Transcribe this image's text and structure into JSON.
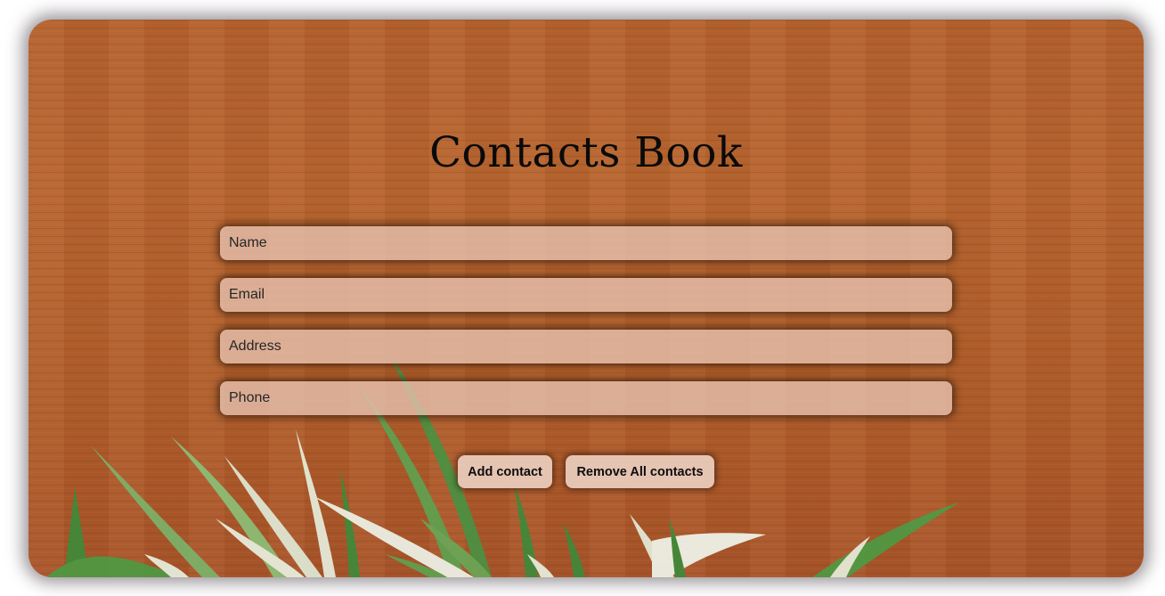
{
  "app": {
    "title": "Contacts Book"
  },
  "form": {
    "fields": [
      {
        "placeholder": "Name",
        "value": ""
      },
      {
        "placeholder": "Email",
        "value": ""
      },
      {
        "placeholder": "Address",
        "value": ""
      },
      {
        "placeholder": "Phone",
        "value": ""
      }
    ]
  },
  "actions": {
    "add_label": "Add contact",
    "remove_all_label": "Remove All contacts"
  },
  "theme": {
    "wood": "#b5622e",
    "field_bg": "#e4beac",
    "button_bg": "#eacdbe",
    "text": "#0a0a0a"
  }
}
